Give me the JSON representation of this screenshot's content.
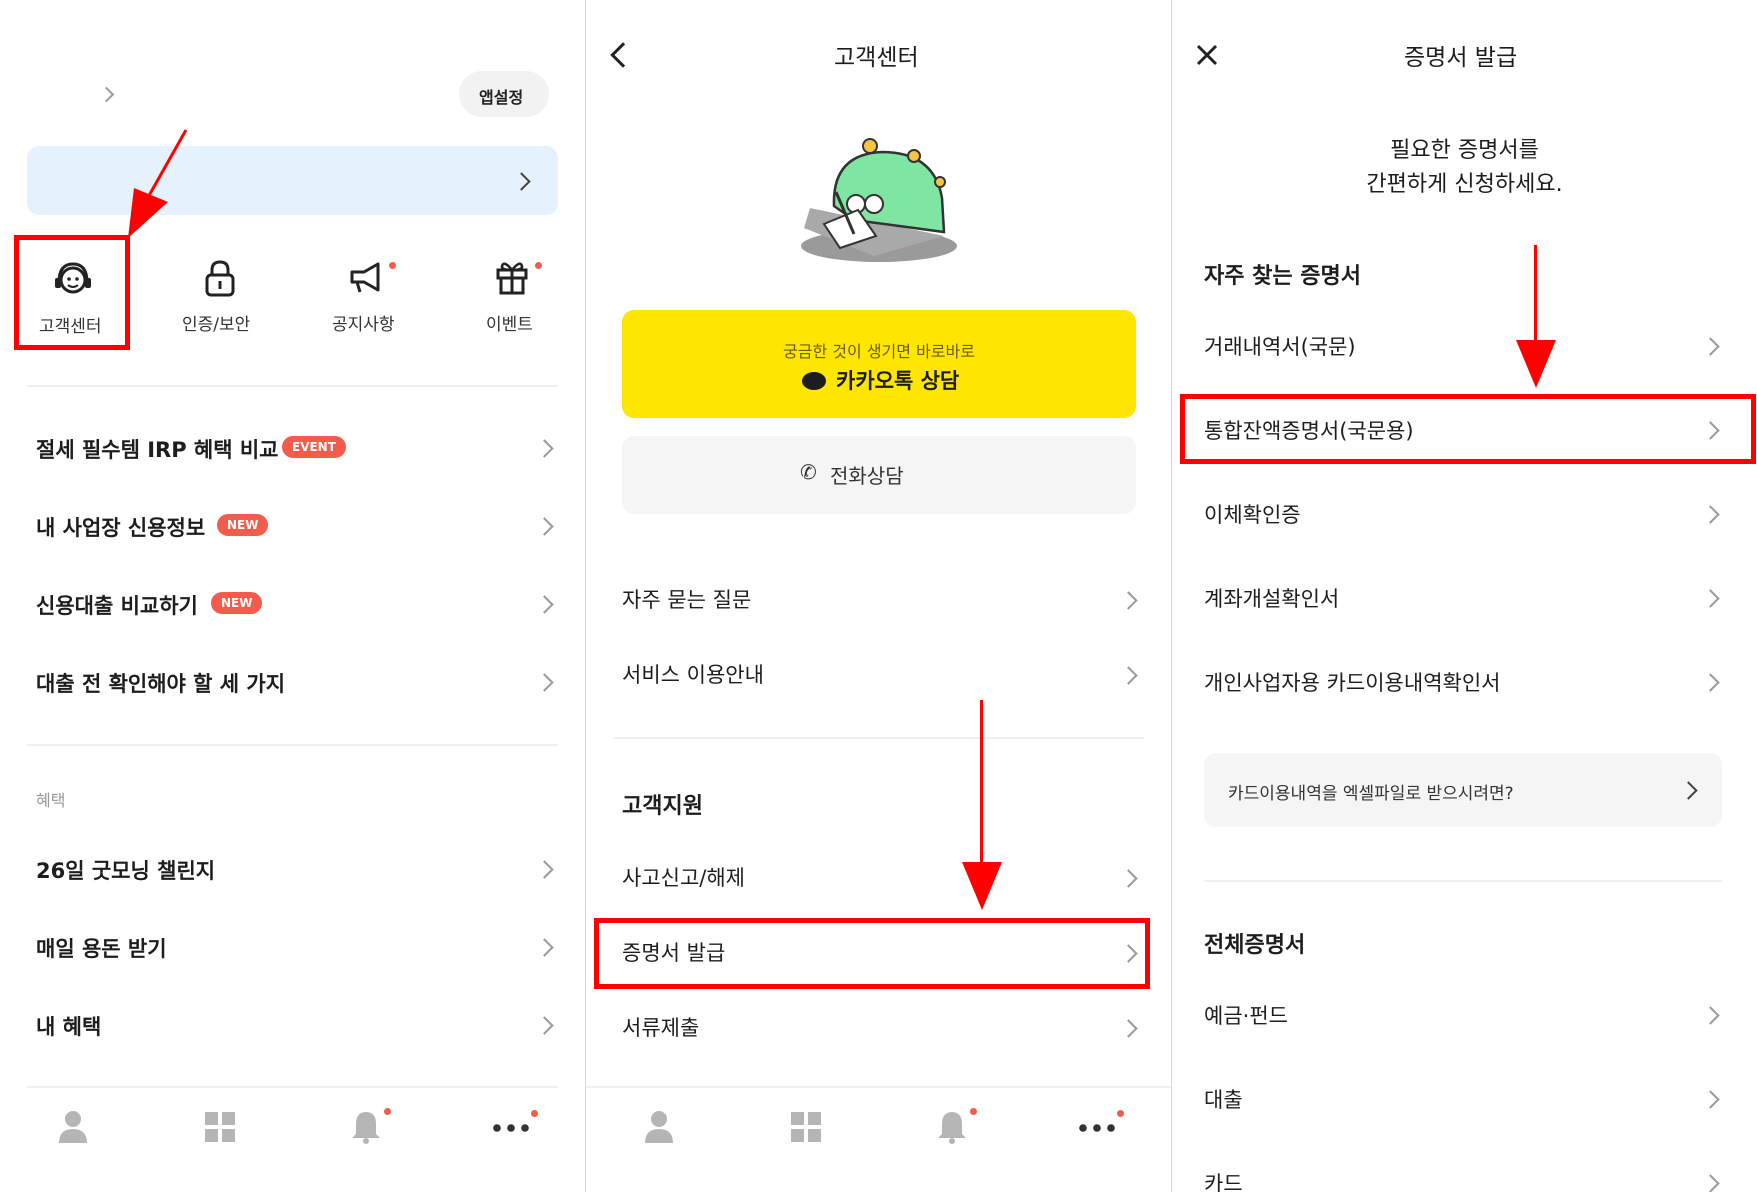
{
  "panel1": {
    "app_settings_label": "앱설정",
    "quick_menu": [
      {
        "label": "고객센터",
        "icon": "headset-icon"
      },
      {
        "label": "인증/보안",
        "icon": "lock-icon"
      },
      {
        "label": "공지사항",
        "icon": "megaphone-icon"
      },
      {
        "label": "이벤트",
        "icon": "gift-icon"
      }
    ],
    "list_items": [
      {
        "label": "절세 필수템 IRP 혜택 비교",
        "badge": "EVENT"
      },
      {
        "label": "내 사업장 신용정보",
        "badge": "NEW"
      },
      {
        "label": "신용대출 비교하기",
        "badge": "NEW"
      },
      {
        "label": "대출 전 확인해야 할 세 가지",
        "badge": ""
      }
    ],
    "benefit_section_label": "혜택",
    "benefit_items": [
      {
        "label": "26일 굿모닝 챌린지"
      },
      {
        "label": "매일 용돈 받기"
      },
      {
        "label": "내 혜택"
      }
    ]
  },
  "panel2": {
    "title": "고객센터",
    "kakao_sub": "궁금한 것이 생기면 바로바로",
    "kakao_main": "카카오톡 상담",
    "phone_label": "전화상담",
    "menu_items": [
      {
        "label": "자주 묻는 질문"
      },
      {
        "label": "서비스 이용안내"
      }
    ],
    "support_heading": "고객지원",
    "support_items": [
      {
        "label": "사고신고/해제"
      },
      {
        "label": "증명서 발급"
      },
      {
        "label": "서류제출"
      }
    ]
  },
  "panel3": {
    "title": "증명서 발급",
    "intro_line1": "필요한 증명서를",
    "intro_line2": "간편하게 신청하세요.",
    "frequent_heading": "자주 찾는 증명서",
    "frequent_items": [
      {
        "label": "거래내역서(국문)"
      },
      {
        "label": "통합잔액증명서(국문용)"
      },
      {
        "label": "이체확인증"
      },
      {
        "label": "계좌개설확인서"
      },
      {
        "label": "개인사업자용 카드이용내역확인서"
      }
    ],
    "excel_banner": "카드이용내역을 엑셀파일로 받으시려면?",
    "all_heading": "전체증명서",
    "all_items": [
      {
        "label": "예금·펀드"
      },
      {
        "label": "대출"
      },
      {
        "label": "카드"
      }
    ]
  },
  "colors": {
    "kakao_yellow": "#ffe600",
    "highlight_red": "#ff0000",
    "badge_red": "#f25c4d",
    "banner_blue": "#e5f2fd"
  }
}
